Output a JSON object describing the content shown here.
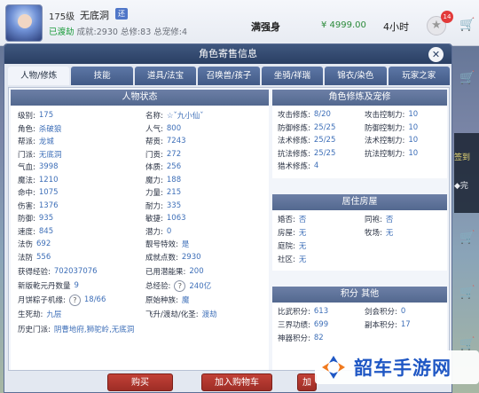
{
  "header": {
    "level": "175级",
    "player_name": "无底洞",
    "server_tag": "还",
    "status_prefix": "已渡劫",
    "status_text": "成就:2930 总修:83 总宠修:4",
    "sell_label": "满强身",
    "price": "¥ 4999.00",
    "duration": "4小时",
    "fav_count": "14"
  },
  "side_ad": {
    "line1": "签到",
    "line2": "◆完"
  },
  "panel": {
    "title": "角色寄售信息",
    "close": "✕",
    "tabs": [
      "人物/修炼",
      "技能",
      "道具/法宝",
      "召唤兽/孩子",
      "坐骑/祥瑞",
      "锦衣/染色",
      "玩家之家"
    ]
  },
  "sections": {
    "char_status": {
      "title": "人物状态"
    },
    "cultivation": {
      "title": "角色修炼及宠修"
    },
    "housing": {
      "title": "居住房屋"
    },
    "points": {
      "title": "积分 其他"
    }
  },
  "char_left": [
    {
      "label": "级别:",
      "value": "175"
    },
    {
      "label": "角色:",
      "value": "杀破狼"
    },
    {
      "label": "帮派:",
      "value": "龙城"
    },
    {
      "label": "门派:",
      "value": "无底洞"
    },
    {
      "label": "气血:",
      "value": "3998"
    },
    {
      "label": "魔法:",
      "value": "1210"
    },
    {
      "label": "命中:",
      "value": "1075"
    },
    {
      "label": "伤害:",
      "value": "1376"
    },
    {
      "label": "防御:",
      "value": "935"
    },
    {
      "label": "速度:",
      "value": "845"
    },
    {
      "label": "法伤",
      "value": "692"
    },
    {
      "label": "法防",
      "value": "556"
    }
  ],
  "char_right": [
    {
      "label": "名称:",
      "value": "☆ˇ九小仙ˇ"
    },
    {
      "label": "人气:",
      "value": "800"
    },
    {
      "label": "帮贡:",
      "value": "7243"
    },
    {
      "label": "门贡:",
      "value": "272"
    },
    {
      "label": "体质:",
      "value": "256"
    },
    {
      "label": "魔力:",
      "value": "188"
    },
    {
      "label": "力量:",
      "value": "215"
    },
    {
      "label": "耐力:",
      "value": "335"
    },
    {
      "label": "敏捷:",
      "value": "1063"
    },
    {
      "label": "潜力:",
      "value": "0"
    },
    {
      "label": "靓号特效:",
      "value": "是"
    },
    {
      "label": "成就点数:",
      "value": "2930"
    }
  ],
  "char_bottom": {
    "exp_label": "获得经验:",
    "exp_value": "702037076",
    "potential_label": "已用潜能果:",
    "potential_value": "200",
    "qiankun_label": "新版乾元丹数量",
    "qiankun_value": "9",
    "total_exp_label": "总经验:",
    "total_exp_value": "240亿",
    "moon_label": "月饼粽子机缘:",
    "moon_value": "18/66",
    "origin_label": "原始种族:",
    "origin_value": "魔",
    "life_label": "生死劫:",
    "life_value": "九层",
    "feisheng_label": "飞升/渡劫/化圣:",
    "feisheng_value": "渡劫",
    "history_label": "历史门派:",
    "history_value": "阴曹地府,狮驼岭,无底洞"
  },
  "cultivation_left": [
    {
      "label": "攻击修炼:",
      "value": "8/20"
    },
    {
      "label": "防御修炼:",
      "value": "25/25"
    },
    {
      "label": "法术修炼:",
      "value": "25/25"
    },
    {
      "label": "抗法修炼:",
      "value": "25/25"
    },
    {
      "label": "猎术修炼:",
      "value": "4"
    }
  ],
  "cultivation_right": [
    {
      "label": "攻击控制力:",
      "value": "10"
    },
    {
      "label": "防御控制力:",
      "value": "10"
    },
    {
      "label": "法术控制力:",
      "value": "10"
    },
    {
      "label": "抗法控制力:",
      "value": "10"
    }
  ],
  "housing_left": [
    {
      "label": "婚否:",
      "value": "否"
    },
    {
      "label": "房屋:",
      "value": "无"
    },
    {
      "label": "庭院:",
      "value": "无"
    },
    {
      "label": "社区:",
      "value": "无"
    }
  ],
  "housing_right": [
    {
      "label": "同袍:",
      "value": "否"
    },
    {
      "label": "牧场:",
      "value": "无"
    }
  ],
  "points_left": [
    {
      "label": "比武积分:",
      "value": "613"
    },
    {
      "label": "三界功绩:",
      "value": "699"
    },
    {
      "label": "神器积分:",
      "value": "82"
    }
  ],
  "points_right": [
    {
      "label": "剑会积分:",
      "value": "0"
    },
    {
      "label": "副本积分:",
      "value": "17"
    }
  ],
  "footer": {
    "buy": "购买",
    "add_cart": "加入购物车",
    "more": "加"
  },
  "watermark": {
    "text": "韶车手游网"
  },
  "colors": {
    "accent": "#3e6fb8",
    "header": "#2a3f63",
    "buy": "#b2362e"
  }
}
